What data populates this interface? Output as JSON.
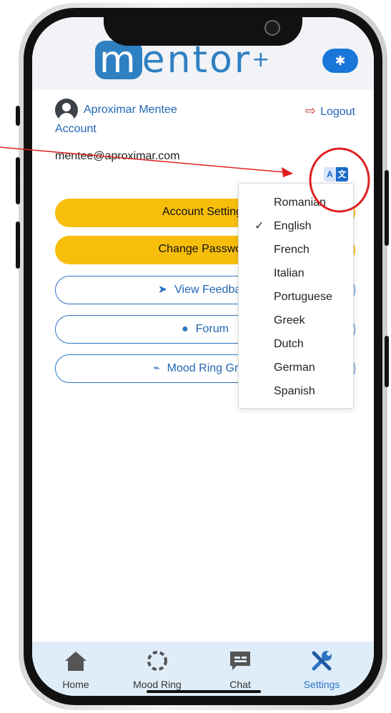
{
  "app": {
    "logo_text": "entor",
    "logo_m": "m",
    "logo_plus": "+",
    "bug_icon": "bug-icon"
  },
  "account": {
    "name": "Aproximar Mentee",
    "subtitle": "Account",
    "email": "mentee@aproximar.com",
    "logout_label": "Logout"
  },
  "language_button": {
    "left": "A",
    "right": "文"
  },
  "buttons": {
    "account_settings": "Account Settings",
    "change_password": "Change Password",
    "view_feedback": "View Feedback",
    "forum": "Forum",
    "mood_ring_graph": "Mood Ring Graph"
  },
  "language_menu": {
    "selected": "English",
    "items": [
      "Romanian",
      "English",
      "French",
      "Italian",
      "Portuguese",
      "Greek",
      "Dutch",
      "German",
      "Spanish"
    ]
  },
  "tabbar": {
    "items": [
      {
        "label": "Home",
        "icon": "home-icon"
      },
      {
        "label": "Mood Ring",
        "icon": "mood-ring-icon"
      },
      {
        "label": "Chat",
        "icon": "chat-icon"
      },
      {
        "label": "Settings",
        "icon": "settings-icon"
      }
    ],
    "active": "Settings"
  },
  "colors": {
    "primary": "#2266b5",
    "accent_yellow": "#f7be0c",
    "annotation_red": "#e02020",
    "tabbar_bg": "#dfedf9"
  }
}
